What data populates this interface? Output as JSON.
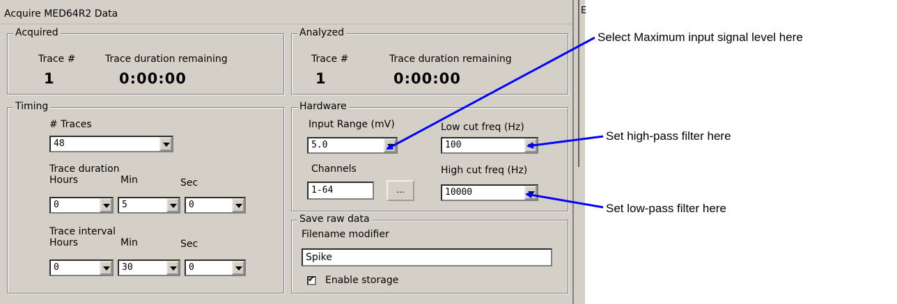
{
  "window": {
    "title": "Acquire MED64R2 Data",
    "right_edge_char": "E"
  },
  "acquired": {
    "legend": "Acquired",
    "trace_label": "Trace #",
    "remaining_label": "Trace duration remaining",
    "trace_value": "1",
    "remaining_value": "0:00:00"
  },
  "analyzed": {
    "legend": "Analyzed",
    "trace_label": "Trace #",
    "remaining_label": "Trace duration remaining",
    "trace_value": "1",
    "remaining_value": "0:00:00"
  },
  "timing": {
    "legend": "Timing",
    "traces_label": "# Traces",
    "traces_value": "48",
    "duration_label": "Trace duration",
    "hours_label": "Hours",
    "min_label": "Min",
    "sec_label": "Sec",
    "duration_hours": "0",
    "duration_min": "5",
    "duration_sec": "0",
    "interval_label": "Trace interval",
    "interval_hours": "0",
    "interval_min": "30",
    "interval_sec": "0"
  },
  "hardware": {
    "legend": "Hardware",
    "input_range_label": "Input Range (mV)",
    "input_range_value": "5.0",
    "low_cut_label": "Low cut freq (Hz)",
    "low_cut_value": "100",
    "channels_label": "Channels",
    "channels_value": "1-64",
    "channels_button": "...",
    "high_cut_label": "High cut freq (Hz)",
    "high_cut_value": "10000"
  },
  "save": {
    "legend": "Save raw data",
    "filename_label": "Filename modifier",
    "filename_value": "Spike",
    "enable_label": "Enable storage",
    "enable_checked": true
  },
  "annotations": {
    "max_input": "Select Maximum input signal level here",
    "high_pass": "Set high-pass filter here",
    "low_pass": "Set low-pass filter here",
    "arrow_color": "#0000ff"
  }
}
